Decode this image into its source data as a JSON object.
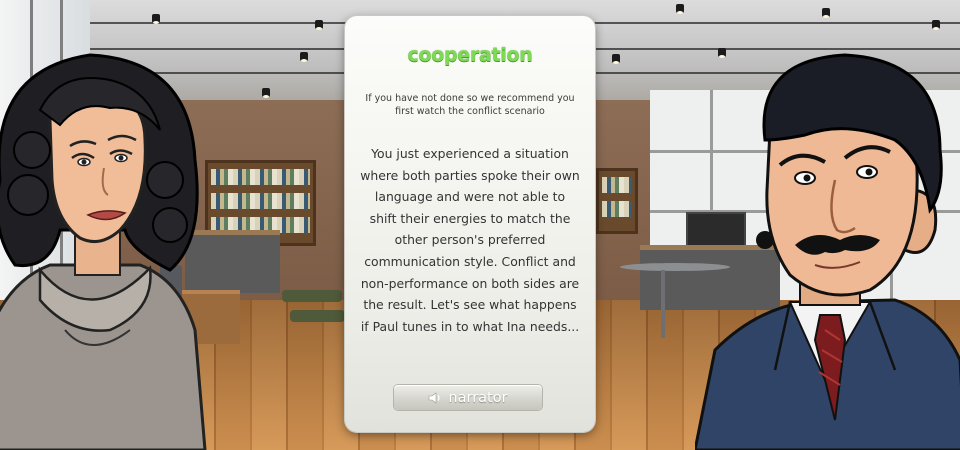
{
  "dialog": {
    "title": "cooperation",
    "subtitle": "If you have not done so we recommend you first watch the conflict scenario",
    "body": "You just experienced a situation where both parties spoke their own language and were not able to shift their energies to match the other person's preferred communication style. Conflict and non-performance on both sides are the result. Let's see what happens if Paul tunes in to what Ina needs...",
    "narrator_label": "narrator",
    "narrator_icon": "speaker-icon"
  },
  "characters": {
    "left": "Ina",
    "right": "Paul"
  },
  "colors": {
    "title_green": "#7ed957",
    "panel_bg": "#f4f4f0",
    "body_text": "#333333"
  }
}
